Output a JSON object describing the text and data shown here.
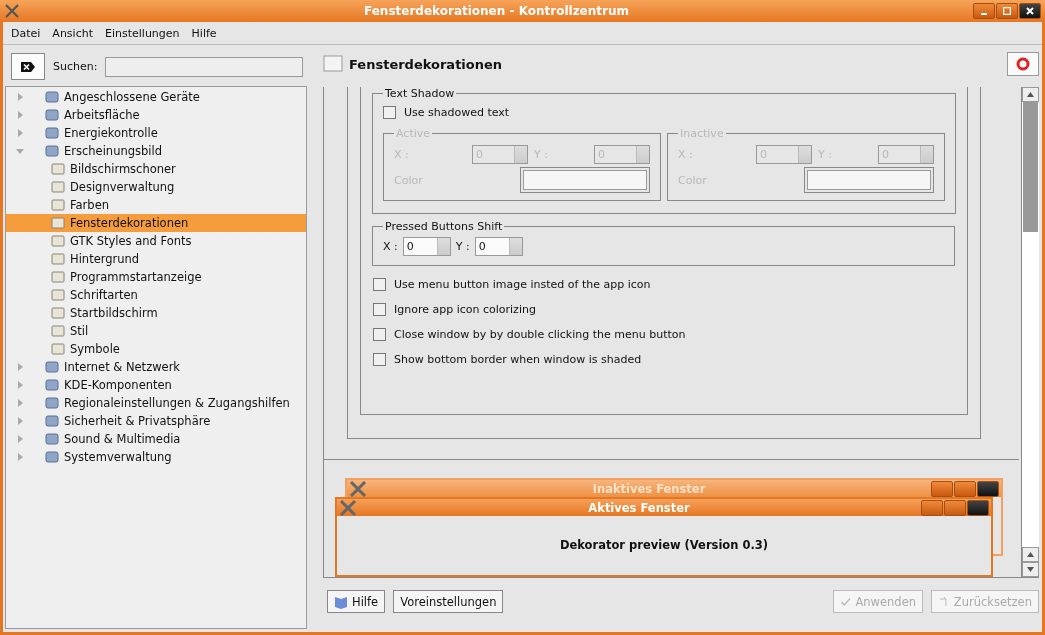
{
  "window": {
    "title": "Fensterdekorationen - Kontrollzentrum"
  },
  "menu": [
    "Datei",
    "Ansicht",
    "Einstellungen",
    "Hilfe"
  ],
  "search": {
    "label": "Suchen:"
  },
  "tree": [
    {
      "label": "Angeschlossene Geräte",
      "expanded": false,
      "selected": false
    },
    {
      "label": "Arbeitsfläche",
      "expanded": false,
      "selected": false
    },
    {
      "label": "Energiekontrolle",
      "expanded": false,
      "selected": false
    },
    {
      "label": "Erscheinungsbild",
      "expanded": true,
      "selected": false,
      "children": [
        {
          "label": "Bildschirmschoner",
          "selected": false
        },
        {
          "label": "Designverwaltung",
          "selected": false
        },
        {
          "label": "Farben",
          "selected": false
        },
        {
          "label": "Fensterdekorationen",
          "selected": true
        },
        {
          "label": "GTK Styles and Fonts",
          "selected": false
        },
        {
          "label": "Hintergrund",
          "selected": false
        },
        {
          "label": "Programmstartanzeige",
          "selected": false
        },
        {
          "label": "Schriftarten",
          "selected": false
        },
        {
          "label": "Startbildschirm",
          "selected": false
        },
        {
          "label": "Stil",
          "selected": false
        },
        {
          "label": "Symbole",
          "selected": false
        }
      ]
    },
    {
      "label": "Internet & Netzwerk",
      "expanded": false,
      "selected": false
    },
    {
      "label": "KDE-Komponenten",
      "expanded": false,
      "selected": false
    },
    {
      "label": "Regionaleinstellungen & Zugangshilfen",
      "expanded": false,
      "selected": false
    },
    {
      "label": "Sicherheit & Privatsphäre",
      "expanded": false,
      "selected": false
    },
    {
      "label": "Sound & Multimedia",
      "expanded": false,
      "selected": false
    },
    {
      "label": "Systemverwaltung",
      "expanded": false,
      "selected": false
    }
  ],
  "panel": {
    "title": "Fensterdekorationen",
    "text_shadow": {
      "title": "Text Shadow",
      "checkbox": {
        "label": "Use shadowed text",
        "checked": false
      },
      "groups": [
        {
          "title": "Active",
          "disabled": true,
          "x_label": "X :",
          "x_value": "0",
          "y_label": "Y :",
          "y_value": "0",
          "color_label": "Color"
        },
        {
          "title": "Inactive",
          "disabled": true,
          "x_label": "X :",
          "x_value": "0",
          "y_label": "Y :",
          "y_value": "0",
          "color_label": "Color"
        }
      ]
    },
    "pressed_shift": {
      "title": "Pressed Buttons Shift",
      "x_label": "X :",
      "x_value": "0",
      "y_label": "Y :",
      "y_value": "0"
    },
    "options": [
      {
        "label": "Use menu button image insted of the app icon",
        "checked": false
      },
      {
        "label": "Ignore app icon colorizing",
        "checked": false
      },
      {
        "label": "Close window by by double clicking the menu button",
        "checked": false
      },
      {
        "label": "Show bottom border when window is shaded",
        "checked": false
      }
    ]
  },
  "preview": {
    "inactive_title": "Inaktives Fenster",
    "active_title": "Aktives Fenster",
    "text": "Dekorator preview (Version 0.3)"
  },
  "buttons": [
    {
      "label": "Hilfe",
      "kind": "help",
      "disabled": false
    },
    {
      "label": "Voreinstellungen",
      "kind": "plain",
      "disabled": false
    },
    {
      "label": "Anwenden",
      "kind": "apply",
      "disabled": true
    },
    {
      "label": "Zurücksetzen",
      "kind": "reset",
      "disabled": true
    }
  ]
}
